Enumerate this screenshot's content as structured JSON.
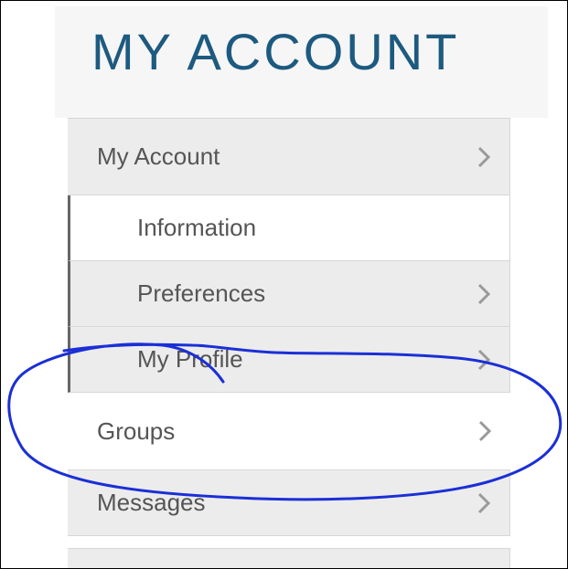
{
  "header": {
    "title": "MY ACCOUNT"
  },
  "nav": {
    "items": [
      {
        "label": "My Account"
      },
      {
        "label": "Information"
      },
      {
        "label": "Preferences"
      },
      {
        "label": "My Profile"
      },
      {
        "label": "Groups"
      },
      {
        "label": "Messages"
      }
    ]
  },
  "colors": {
    "title": "#1d5a80",
    "annotation": "#1b2fd6",
    "nav_bg": "#ececec"
  }
}
